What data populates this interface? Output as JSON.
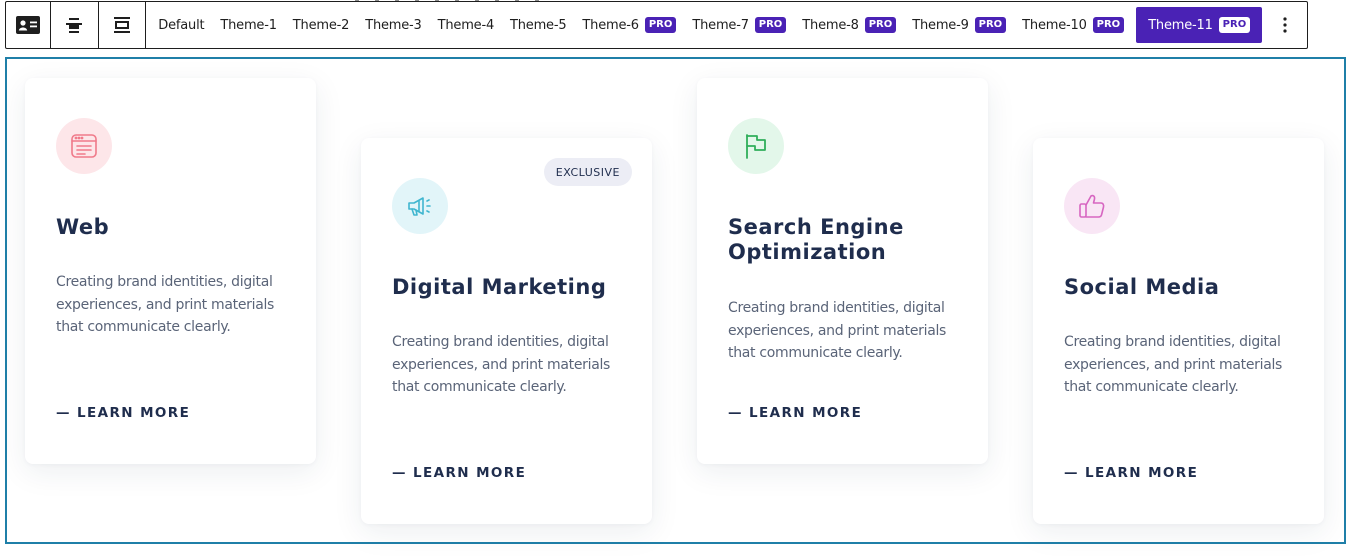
{
  "toolbar": {
    "buttons": [
      {
        "icon": "block-card-icon"
      },
      {
        "icon": "align-center-icon"
      },
      {
        "icon": "align-wide-icon"
      }
    ],
    "tabs": [
      {
        "label": "Default",
        "pro": ""
      },
      {
        "label": "Theme-1",
        "pro": ""
      },
      {
        "label": "Theme-2",
        "pro": ""
      },
      {
        "label": "Theme-3",
        "pro": ""
      },
      {
        "label": "Theme-4",
        "pro": ""
      },
      {
        "label": "Theme-5",
        "pro": ""
      },
      {
        "label": "Theme-6",
        "pro": "PRO"
      },
      {
        "label": "Theme-7",
        "pro": "PRO"
      },
      {
        "label": "Theme-8",
        "pro": "PRO"
      },
      {
        "label": "Theme-9",
        "pro": "PRO"
      },
      {
        "label": "Theme-10",
        "pro": "PRO"
      },
      {
        "label": "Theme-11",
        "pro": "PRO",
        "active": true
      }
    ],
    "more_icon": "more-vertical-icon",
    "accent_color": "#4a22b5"
  },
  "frame": {
    "border_color": "#1f7fa8"
  },
  "cards": [
    {
      "title": "Web",
      "description": "Creating brand identities, digital experiences, and print materials that communicate clearly.",
      "link": "— LEARN MORE",
      "icon": "browser-window-icon",
      "icon_color": "#f07a8a",
      "icon_bg": "#fde6e9",
      "badge": ""
    },
    {
      "title": "Digital Marketing",
      "description": "Creating brand identities, digital experiences, and print materials that communicate clearly.",
      "link": "— LEARN MORE",
      "icon": "megaphone-icon",
      "icon_color": "#3fb6cf",
      "icon_bg": "#e2f5f9",
      "badge": "EXCLUSIVE"
    },
    {
      "title": "Search Engine Optimization",
      "description": "Creating brand identities, digital experiences, and print materials that communicate clearly.",
      "link": "— LEARN MORE",
      "icon": "flag-icon",
      "icon_color": "#2fae5a",
      "icon_bg": "#e3f7ea",
      "badge": ""
    },
    {
      "title": "Social Media",
      "description": "Creating brand identities, digital experiences, and print materials that communicate clearly.",
      "link": "— LEARN MORE",
      "icon": "thumbs-up-icon",
      "icon_color": "#d766c1",
      "icon_bg": "#f9e6f5",
      "badge": ""
    }
  ]
}
